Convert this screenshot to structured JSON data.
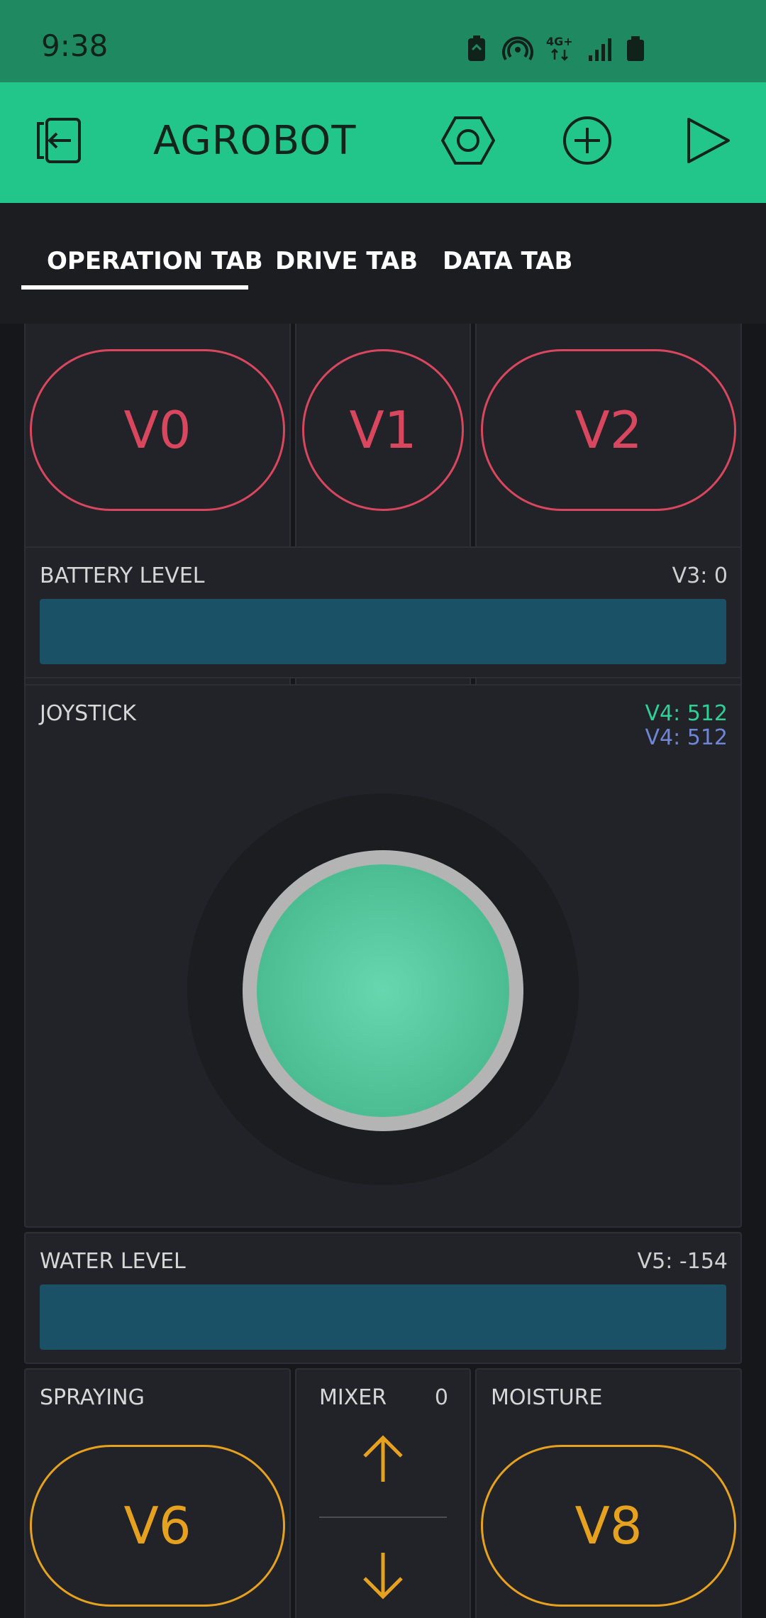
{
  "status_bar": {
    "time": "9:38",
    "icons": [
      "battery-saver-icon",
      "hotspot-icon",
      "network-4g-icon",
      "signal-icon",
      "battery-icon"
    ],
    "network_label": "4G+"
  },
  "app_bar": {
    "title": "AGROBOT",
    "icons": [
      "exit-icon",
      "settings-hex-icon",
      "add-circle-icon",
      "play-icon"
    ]
  },
  "tabs": [
    {
      "label": "OPERATION TAB",
      "active": true
    },
    {
      "label": "DRIVE TAB",
      "active": false
    },
    {
      "label": "DATA TAB",
      "active": false
    }
  ],
  "buttons_top": [
    {
      "label": "V0"
    },
    {
      "label": "V1"
    },
    {
      "label": "V2"
    }
  ],
  "battery": {
    "label": "BATTERY LEVEL",
    "pin": "V3: 0",
    "level": 0
  },
  "joystick": {
    "label": "JOYSTICK",
    "x_pin": "V4: 512",
    "y_pin": "V4: 512"
  },
  "water": {
    "label": "WATER LEVEL",
    "pin": "V5: -154"
  },
  "spraying": {
    "label": "SPRAYING",
    "button": "V6"
  },
  "mixer": {
    "label": "MIXER",
    "value": "0"
  },
  "moisture": {
    "label": "MOISTURE",
    "button": "V8"
  },
  "colors": {
    "accent": "#23c68a",
    "status_bar": "#1f8a62",
    "button_red": "#d9475f",
    "button_orange": "#e6a21e",
    "joystick_x": "#2fd095",
    "joystick_y": "#6f86d6",
    "level_bar": "#1b5167"
  }
}
